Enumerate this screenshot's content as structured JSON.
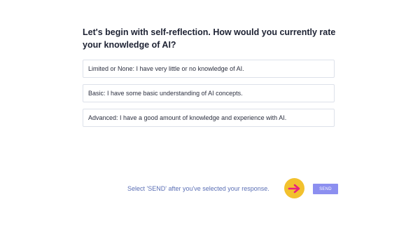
{
  "question": {
    "text": "Let's begin with self-reflection. How would you currently rate your knowledge of AI?"
  },
  "options": [
    {
      "label": "Limited or None: I have very little or no knowledge of AI."
    },
    {
      "label": "Basic: I have some basic understanding of AI concepts."
    },
    {
      "label": "Advanced: I have a good amount of knowledge and experience with AI."
    }
  ],
  "footer": {
    "hint": "Select 'SEND' after you've selected your response.",
    "arrow_icon": "arrow-right-icon",
    "send_label": "SEND"
  },
  "colors": {
    "arrow_badge": "#f2c12e",
    "arrow": "#e8217f",
    "send_button": "#8c8ff0",
    "hint_text": "#5b6fb5"
  }
}
